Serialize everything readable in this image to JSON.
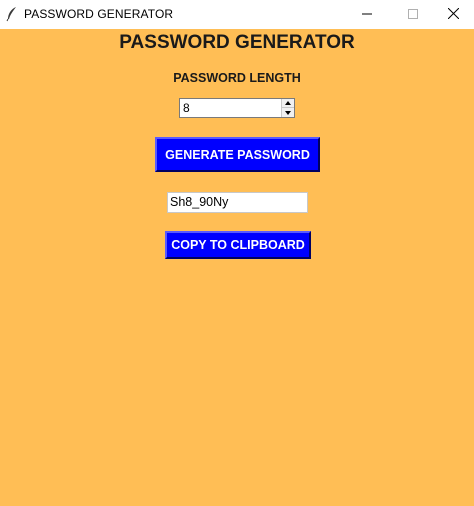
{
  "window": {
    "title": "PASSWORD GENERATOR",
    "icon": "feather-icon",
    "controls": [
      "minimize-icon",
      "maximize-icon",
      "close-icon"
    ]
  },
  "main": {
    "heading": "PASSWORD GENERATOR",
    "length_label": "PASSWORD LENGTH",
    "length_value": "8",
    "generate_button": "GENERATE PASSWORD",
    "password_value": "Sh8_90Ny",
    "copy_button": "COPY TO CLIPBOARD"
  },
  "colors": {
    "background": "#ffbe55",
    "button": "#0000ff",
    "button_text": "#ffffff"
  }
}
